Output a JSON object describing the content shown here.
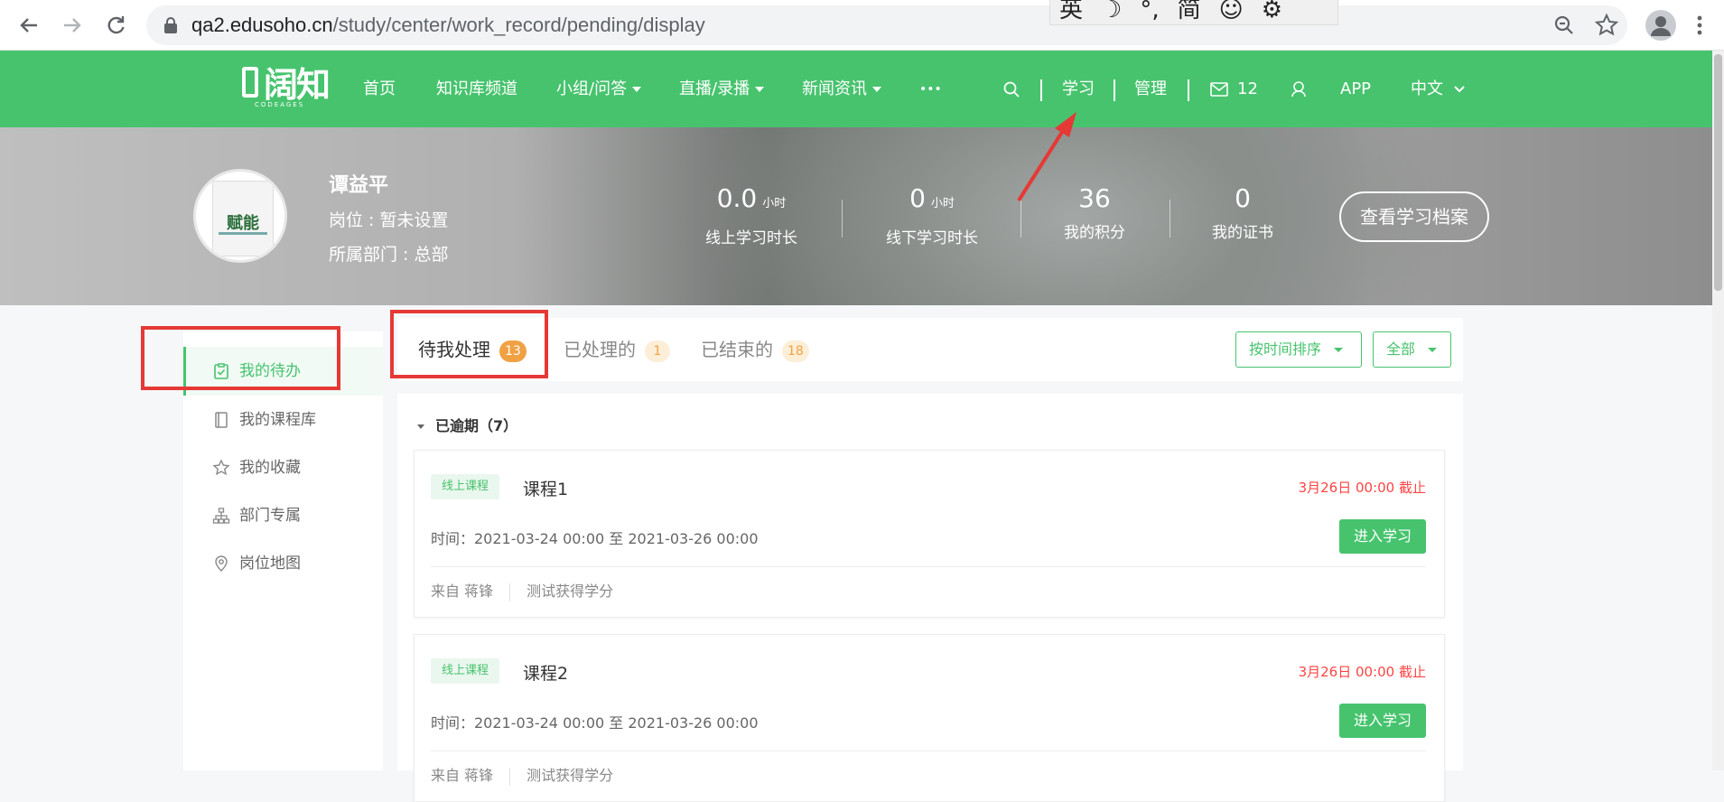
{
  "browser": {
    "url_host": "qa2.edusoho.cn",
    "url_path": "/study/center/work_record/pending/display",
    "ime": [
      "英",
      "☽",
      "°,",
      "简",
      "☺",
      "⚙"
    ]
  },
  "header": {
    "logo_text": "阔知",
    "logo_sub": "CODEAGES",
    "nav": [
      {
        "label": "首页"
      },
      {
        "label": "知识库频道"
      },
      {
        "label": "小组/问答"
      },
      {
        "label": "直播/录播"
      },
      {
        "label": "新闻资讯"
      },
      {
        "label": "•••"
      }
    ],
    "study": "学习",
    "manage": "管理",
    "msg_count": "12",
    "app": "APP",
    "lang": "中文"
  },
  "profile": {
    "name": "谭益平",
    "position": "岗位 : 暂未设置",
    "department": "所属部门 : 总部",
    "cover_text": "赋能",
    "stats": [
      {
        "value": "0.0",
        "unit": "小时",
        "label": "线上学习时长"
      },
      {
        "value": "0",
        "unit": "小时",
        "label": "线下学习时长"
      },
      {
        "value": "36",
        "unit": "",
        "label": "我的积分"
      },
      {
        "value": "0",
        "unit": "",
        "label": "我的证书"
      }
    ],
    "archive_button": "查看学习档案"
  },
  "sidebar": {
    "items": [
      {
        "label": "我的待办",
        "icon": "clipboard-check-icon",
        "active": true
      },
      {
        "label": "我的课程库",
        "icon": "book-icon"
      },
      {
        "label": "我的收藏",
        "icon": "star-icon"
      },
      {
        "label": "部门专属",
        "icon": "org-chart-icon"
      },
      {
        "label": "岗位地图",
        "icon": "map-pin-icon"
      }
    ]
  },
  "tabs": [
    {
      "label": "待我处理",
      "count": "13",
      "active": true
    },
    {
      "label": "已处理的",
      "count": "1"
    },
    {
      "label": "已结束的",
      "count": "18"
    }
  ],
  "filters": {
    "sort": "按时间排序",
    "scope": "全部"
  },
  "group": {
    "title": "已逾期（7）"
  },
  "cards": [
    {
      "tag": "线上课程",
      "title": "课程1",
      "deadline": "3月26日 00:00 截止",
      "time": "时间：2021-03-24 00:00 至 2021-03-26 00:00",
      "button": "进入学习",
      "from": "来自 蒋锋",
      "note": "测试获得学分"
    },
    {
      "tag": "线上课程",
      "title": "课程2",
      "deadline": "3月26日 00:00 截止",
      "time": "时间：2021-03-24 00:00 至 2021-03-26 00:00",
      "button": "进入学习",
      "from": "来自 蒋锋",
      "note": "测试获得学分"
    }
  ],
  "colors": {
    "brand_green": "#47c36e",
    "deadline_red": "#ff4444",
    "badge_orange": "#f0a144",
    "annotation_red": "#e53935"
  }
}
